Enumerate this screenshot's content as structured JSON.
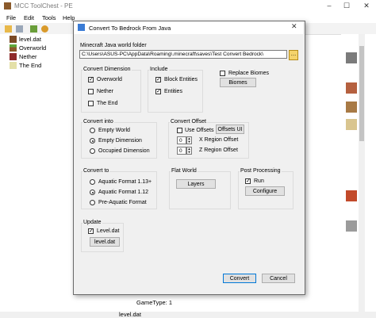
{
  "window": {
    "title": "MCC ToolChest - PE"
  },
  "menu": [
    "File",
    "Edit",
    "Tools",
    "Help"
  ],
  "tree": {
    "items": [
      {
        "label": "level.dat",
        "icon": "level-icon"
      },
      {
        "label": "Overworld",
        "icon": "grass-block-icon"
      },
      {
        "label": "Nether",
        "icon": "netherrack-icon"
      },
      {
        "label": "The End",
        "icon": "endstone-icon"
      }
    ]
  },
  "bottom_panel": {
    "gametype": "GameType: 1",
    "status_file": "level.dat"
  },
  "dialog": {
    "title": "Convert To Bedrock From Java",
    "path_label": "Minecraft Java world folder",
    "path_value": "C:\\Users\\ASUS-PC\\AppData\\Roaming\\.minecraft\\saves\\Test Convert Bedrock\\",
    "convert_dimension": {
      "title": "Convert Dimension",
      "options": [
        {
          "label": "Overworld",
          "checked": true
        },
        {
          "label": "Nether",
          "checked": false
        },
        {
          "label": "The End",
          "checked": false
        }
      ]
    },
    "include": {
      "title": "Include",
      "options": [
        {
          "label": "Block Entities",
          "checked": true
        },
        {
          "label": "Entities",
          "checked": true
        }
      ]
    },
    "replace_biomes": {
      "label": "Replace Biomes",
      "checked": false,
      "button": "Biomes"
    },
    "convert_into": {
      "title": "Convert into",
      "options": [
        {
          "label": "Empty World",
          "selected": false
        },
        {
          "label": "Empty Dimension",
          "selected": true
        },
        {
          "label": "Occupied Dimension",
          "selected": false
        }
      ]
    },
    "convert_offset": {
      "title": "Convert Offset",
      "use_offsets": "Use Offsets",
      "use_offsets_checked": false,
      "offsets_button": "Offsets UI",
      "x_value": "0",
      "x_label": "X Region Offset",
      "z_value": "0",
      "z_label": "Z Region Offset"
    },
    "convert_to": {
      "title": "Convert to",
      "options": [
        {
          "label": "Aquatic Format 1.13+",
          "selected": false
        },
        {
          "label": "Aquatic Format 1.12",
          "selected": true
        },
        {
          "label": "Pre-Aquatic Format",
          "selected": false
        }
      ]
    },
    "flat_world": {
      "title": "Flat World",
      "button": "Layers"
    },
    "post_processing": {
      "title": "Post Processing",
      "run_label": "Run",
      "run_checked": true,
      "button": "Configure"
    },
    "update": {
      "title": "Update",
      "level_label": "Level.dat",
      "level_checked": true,
      "button": "level.dat"
    },
    "convert_button": "Convert",
    "cancel_button": "Cancel"
  },
  "colors": {
    "accent": "#0078d7",
    "browse": "#f5d36b"
  }
}
